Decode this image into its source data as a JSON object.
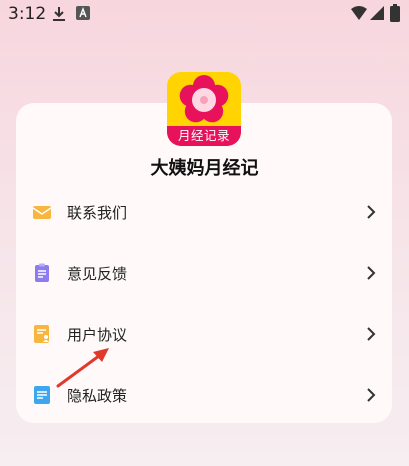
{
  "status_bar": {
    "time": "3:12"
  },
  "app": {
    "banner_text": "月经记录",
    "title": "大姨妈月经记"
  },
  "menu": [
    {
      "label": "联系我们",
      "icon": "mail-icon",
      "color": "#f6b63f"
    },
    {
      "label": "意见反馈",
      "icon": "feedback-clipboard-icon",
      "color": "#8c7cf0"
    },
    {
      "label": "用户协议",
      "icon": "user-agreement-icon",
      "color": "#f6b63f"
    },
    {
      "label": "隐私政策",
      "icon": "privacy-document-icon",
      "color": "#3ea6ef"
    }
  ],
  "annotation": {
    "arrow_color": "#e0392b"
  }
}
